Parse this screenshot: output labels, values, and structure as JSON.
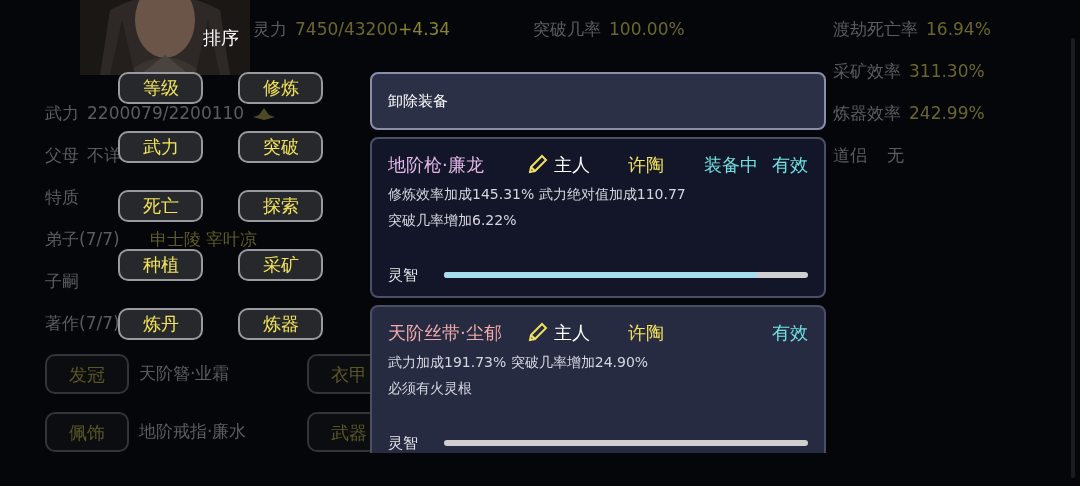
{
  "attributes": [
    {
      "label": "灵力",
      "value": "7450/43200",
      "bonus": "+4.34"
    },
    {
      "label": "突破几率",
      "value": "100.00%"
    },
    {
      "label": "渡劫死亡率",
      "value": "16.94%"
    },
    {
      "label": "采矿效率",
      "value": "311.30%"
    },
    {
      "label": "炼器效率",
      "value": "242.99%"
    }
  ],
  "combat": {
    "label": "武力",
    "value": "2200079/2200110"
  },
  "details": [
    {
      "label": "父母",
      "value": "不详",
      "highlighted": false
    },
    {
      "label": "道侣",
      "value": "无",
      "highlighted": false
    },
    {
      "label": "特质"
    },
    {
      "label": "弟子(7/7)",
      "value": "申士陵 宰叶凉",
      "highlighted": true
    },
    {
      "label": "子嗣"
    },
    {
      "label": "著作(7/7)"
    }
  ],
  "equipment_slots": [
    {
      "slot": "发冠",
      "item": "天阶簪·业霜"
    },
    {
      "slot": "衣甲"
    },
    {
      "slot": "佩饰",
      "item": "地阶戒指·廉水"
    },
    {
      "slot": "武器"
    }
  ],
  "sort_menu": {
    "title": "排序",
    "options": [
      "等级",
      "修炼",
      "武力",
      "突破",
      "死亡",
      "探索",
      "种植",
      "采矿",
      "炼丹",
      "炼器"
    ]
  },
  "panel": {
    "unequip_button": "卸除装备",
    "items": [
      {
        "name": "地阶枪·廉龙",
        "color": "#e2b6ea",
        "owner_label": "主人",
        "owner": "许陶",
        "equipped": true,
        "equipped_label": "装备中",
        "status": "有效",
        "effects": [
          "修炼效率加成145.31% 武力绝对值加成110.77",
          "突破几率增加6.22%"
        ],
        "bar_label": "灵智",
        "level": 0.86
      },
      {
        "name": "天阶丝带·尘郁",
        "color": "#f2aaa8",
        "owner_label": "主人",
        "owner": "许陶",
        "equipped": false,
        "status": "有效",
        "effects": [
          "武力加成191.73% 突破几率增加24.90%",
          "必须有火灵根"
        ],
        "bar_label": "灵智",
        "level": 0
      }
    ]
  }
}
